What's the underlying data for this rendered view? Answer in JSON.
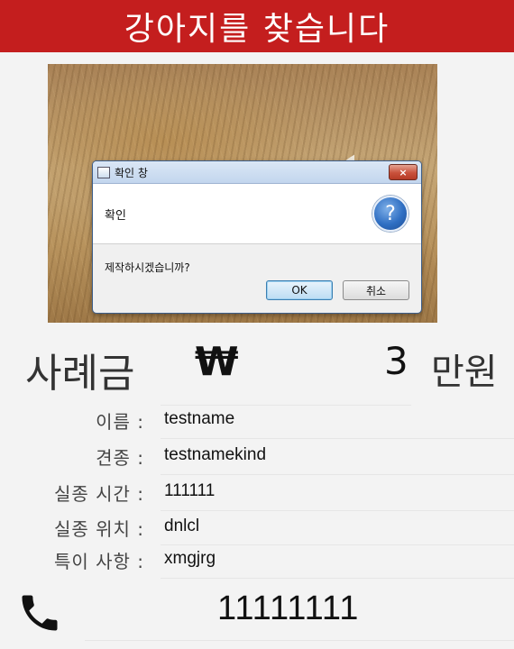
{
  "header": {
    "title": "강아지를 찾습니다"
  },
  "photo": {
    "icon": "dog-photo"
  },
  "dialog": {
    "title": "확인 창",
    "close_label": "×",
    "header_text": "확인",
    "question_icon": "?",
    "content": "제작하시겠습니까?",
    "ok_label": "OK",
    "cancel_label": "취소"
  },
  "reward": {
    "label": "사례금",
    "currency": "₩",
    "amount": "3",
    "unit": "만원"
  },
  "info": {
    "name_label": "이름 :",
    "name_value": "testname",
    "breed_label": "견종 :",
    "breed_value": "testnamekind",
    "time_label": "실종 시간 :",
    "time_value": "111111",
    "location_label": "실종 위치 :",
    "location_value": "dnlcl",
    "notes_label": "특이 사항 :",
    "notes_value": "xmgjrg"
  },
  "contact": {
    "icon": "phone-icon",
    "phone": "11111111"
  }
}
